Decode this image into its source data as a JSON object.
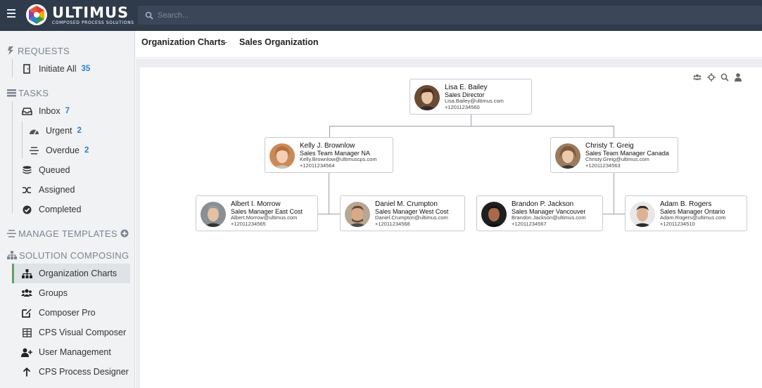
{
  "app": {
    "logo_name": "ULTIMUS",
    "logo_tagline": "COMPOSED PROCESS SOLUTIONS",
    "search_placeholder": "Search...",
    "brand_colors": [
      "#e03c31",
      "#f7a800",
      "#2e9e44",
      "#2f7fd0"
    ]
  },
  "sidebar": {
    "requests_header": "REQUESTS",
    "initiate_label": "Initiate All",
    "initiate_count": "35",
    "tasks_header": "TASKS",
    "inbox_label": "Inbox",
    "inbox_count": "7",
    "urgent_label": "Urgent",
    "urgent_count": "2",
    "overdue_label": "Overdue",
    "overdue_count": "2",
    "queued_label": "Queued",
    "assigned_label": "Assigned",
    "completed_label": "Completed",
    "manage_header": "MANAGE TEMPLATES",
    "solution_header": "SOLUTION COMPOSING",
    "items": [
      {
        "label": "Organization Charts",
        "icon": "org-chart-icon",
        "active": true
      },
      {
        "label": "Groups",
        "icon": "users-icon",
        "active": false
      },
      {
        "label": "Composer Pro",
        "icon": "edit-icon",
        "active": false
      },
      {
        "label": "CPS Visual Composer",
        "icon": "grid-icon",
        "active": false
      },
      {
        "label": "User Management",
        "icon": "user-plus-icon",
        "active": false
      },
      {
        "label": "CPS Process Designer",
        "icon": "arrow-up-icon",
        "active": false
      }
    ]
  },
  "breadcrumb": {
    "section": "Organization Charts",
    "separator": "-",
    "page": "Sales Organization"
  },
  "org": {
    "director": {
      "name": "Lisa E. Bailey",
      "role": "Sales Director",
      "email": "Lisa.Bailey@ultimus.com",
      "phone": "+12011234560"
    },
    "managers": [
      {
        "name": "Kelly J. Brownlow",
        "role": "Sales Team Manager NA",
        "email": "Kelly.Brownlow@ultimuscps.com",
        "phone": "+12011234564"
      },
      {
        "name": "Christy T. Greig",
        "role": "Sales Team Manager Canada",
        "email": "Christy.Greig@ultimus.com",
        "phone": "+12011234563"
      }
    ],
    "reps": [
      {
        "name": "Albert I. Morrow",
        "role": "Sales Manager East Cost",
        "email": "Albert.Morrow@ultimus.com",
        "phone": "+12011234565"
      },
      {
        "name": "Daniel M. Crumpton",
        "role": "Sales Manager West Cost",
        "email": "Daniel.Crumpton@ultimus.com",
        "phone": "+12011234568"
      },
      {
        "name": "Brandon P. Jackson",
        "role": "Sales Manager Vancouver",
        "email": "Brandon.Jackson@ultimus.com",
        "phone": "+12011234567"
      },
      {
        "name": "Adam B. Rogers",
        "role": "Sales Manager Ontario",
        "email": "Adam.Rogers@ultimus.com",
        "phone": "+12011234510"
      }
    ]
  },
  "toolbar_icons": [
    "users-icon",
    "move-icon",
    "zoom-icon",
    "user-icon"
  ]
}
